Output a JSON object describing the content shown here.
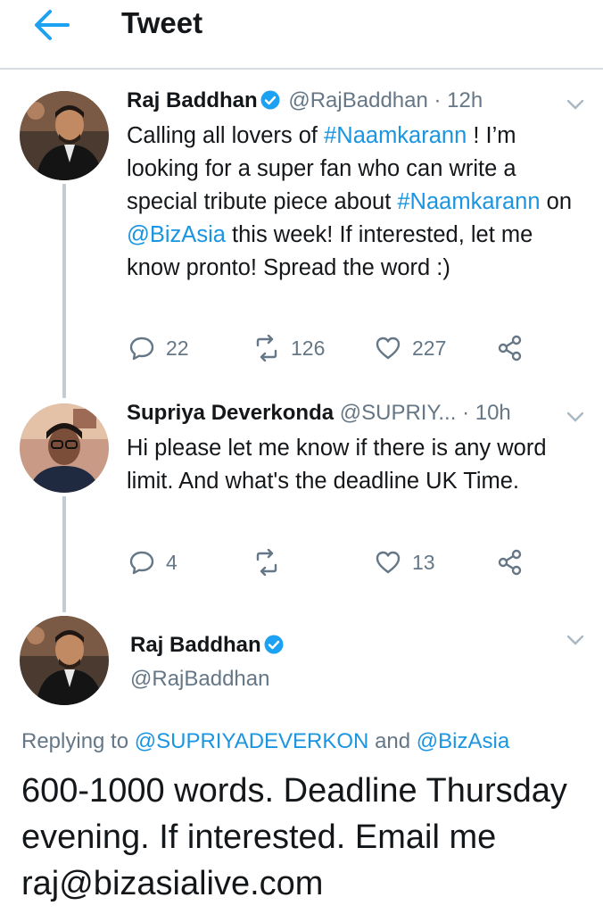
{
  "header": {
    "title": "Tweet",
    "back_icon": "arrow-left-icon",
    "accent": "#1da1f2"
  },
  "tweets": [
    {
      "name": "Raj Baddhan",
      "verified": true,
      "handle": "@RajBaddhan",
      "time": "· 12h",
      "text_parts": [
        "Calling all lovers of ",
        "#Naamkarann",
        " ! I’m looking for a super fan who can write a special tribute piece about ",
        "#Naamkarann",
        " on ",
        "@BizAsia",
        " this week! If interested, let me know pronto! Spread the word :)"
      ],
      "replies": "22",
      "retweets": "126",
      "likes": "227"
    },
    {
      "name": "Supriya Deverkonda",
      "handle": "@SUPRIY...",
      "time": "· 10h",
      "text": "Hi please let me know if there is any word limit. And what's the deadline UK Time.",
      "replies": "4",
      "retweets": "",
      "likes": "13"
    }
  ],
  "main_tweet": {
    "name": "Raj Baddhan",
    "verified": true,
    "handle": "@RajBaddhan",
    "replying_prefix": "Replying to",
    "replying_user1": "@SUPRIYADEVERKON",
    "replying_and": "and",
    "replying_user2": "@BizAsia",
    "text": "600-1000 words. Deadline Thursday evening. If interested. Email me raj@bizasialive.com"
  },
  "colors": {
    "link": "#1b95e0",
    "muted": "#657786",
    "verified": "#1da1f2"
  }
}
